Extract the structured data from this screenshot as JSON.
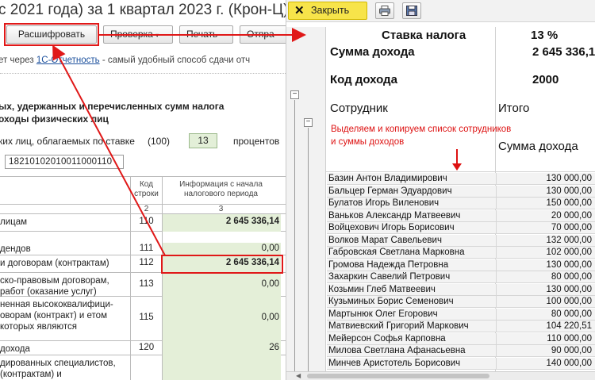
{
  "left": {
    "title": "с 2021 года) за 1 квартал 2023 г. (Крон-Ц)",
    "buttons": {
      "decode": "Расшифровать",
      "check": "Проверка",
      "print": "Печать",
      "send": "Отпра"
    },
    "hint": {
      "prefix": "ет через ",
      "link": "1С-Отчетность",
      "suffix": " - самый удобный способ сдачи отч"
    },
    "section_line1": "ых, удержанных и перечисленных сумм налога",
    "section_line2": "оходы физических лиц",
    "rate_label": "ких лиц, облагаемых по ставке",
    "rate_code": "(100)",
    "rate_value": "13",
    "rate_suffix": "процентов",
    "kbk": "18210102010011000110",
    "table": {
      "header": {
        "c2": "Код строки",
        "c3": "Информация с начала налогового периода"
      },
      "num_row": {
        "c2": "2",
        "c3": "3"
      },
      "rows": [
        {
          "label": "лицам",
          "code": "110",
          "value": "2 645 336,14"
        },
        {
          "label": "дендов",
          "code": "111",
          "value": "0,00"
        },
        {
          "label": "и договорам (контрактам)",
          "code": "112",
          "value": "2 645 336,14"
        },
        {
          "label": "ско-правовым договорам, работ (оказание услуг)",
          "code": "113",
          "value": "0,00"
        },
        {
          "label": "ненная высококвалифици- оворам (контракт) и етом которых являются",
          "code": "115",
          "value": "0,00"
        },
        {
          "label": "дохода",
          "code": "120",
          "value": "26"
        },
        {
          "label": "дированных специалистов, (контрактам) и",
          "code": "",
          "value": ""
        }
      ]
    }
  },
  "right": {
    "close_label": "Закрыть",
    "rate_label": "Ставка налога",
    "rate_value": "13 %",
    "income_label": "Сумма дохода",
    "income_value": "2 645 336,1",
    "code_label": "Код дохода",
    "code_value": "2000",
    "employee_header": "Сотрудник",
    "total_header": "Итого",
    "sum_header": "Сумма дохода",
    "note_line1": "Выделяем и копируем список сотрудников",
    "note_line2": "и суммы доходов",
    "employees": [
      {
        "name": "Базин Антон Владимирович",
        "amount": "130 000,00"
      },
      {
        "name": "Бальцер Герман Эдуардович",
        "amount": "130 000,00"
      },
      {
        "name": "Булатов Игорь Виленович",
        "amount": "150 000,00"
      },
      {
        "name": "Ваньков Александр Матвеевич",
        "amount": "20 000,00"
      },
      {
        "name": "Войцехович Игорь Борисович",
        "amount": "70 000,00"
      },
      {
        "name": "Волков Марат Савельевич",
        "amount": "132 000,00"
      },
      {
        "name": "Габровская Светлана Марковна",
        "amount": "102 000,00"
      },
      {
        "name": "Громова Надежда Петровна",
        "amount": "130 000,00"
      },
      {
        "name": "Захаркин Савелий Петрович",
        "amount": "80 000,00"
      },
      {
        "name": "Козьмин Глеб Матвеевич",
        "amount": "130 000,00"
      },
      {
        "name": "Кузьминых Борис Семенович",
        "amount": "100 000,00"
      },
      {
        "name": "Мартынюк Олег Егорович",
        "amount": "80 000,00"
      },
      {
        "name": "Матвиевский Григорий Маркович",
        "amount": "104 220,51"
      },
      {
        "name": "Мейерсон Софья Карповна",
        "amount": "110 000,00"
      },
      {
        "name": "Милова Светлана Афанасьевна",
        "amount": "90 000,00"
      },
      {
        "name": "Минчев Аристотель Борисович",
        "amount": "140 000,00"
      }
    ]
  },
  "colors": {
    "annotation_red": "#e01818",
    "close_button": "#f7e44a",
    "cell_green": "#e4efd8",
    "note_red": "#d11111"
  },
  "icons": [
    "close-icon",
    "printer-icon",
    "floppy-save-icon",
    "dropdown-arrow-icon",
    "collapse-minus-icon"
  ]
}
